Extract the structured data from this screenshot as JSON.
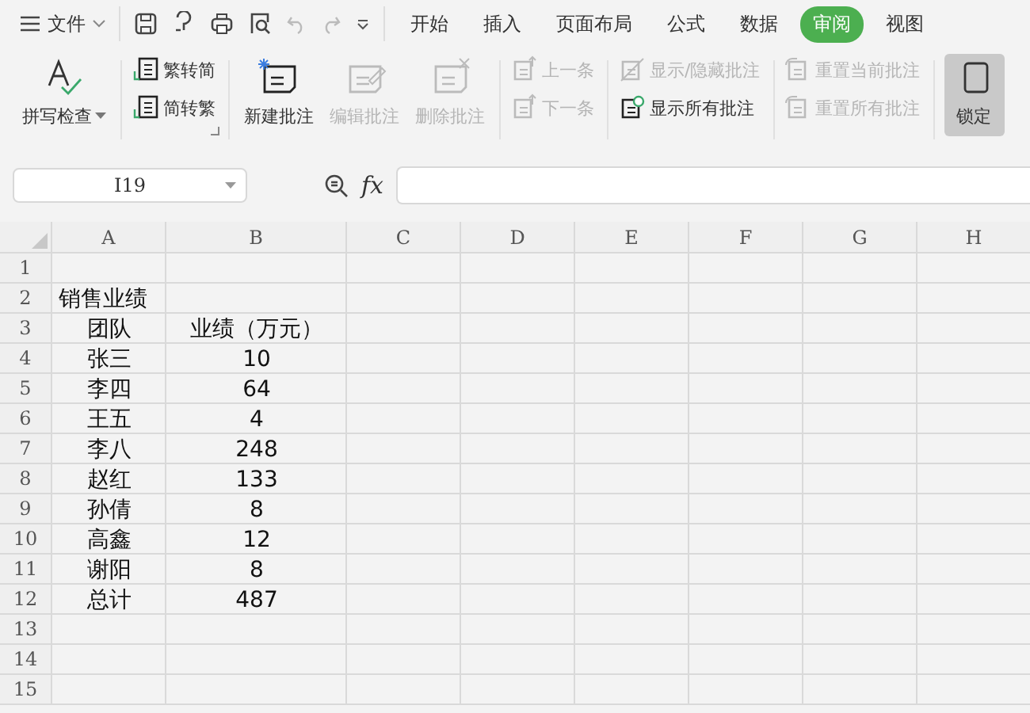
{
  "file_menu": {
    "label": "文件"
  },
  "tabs": [
    {
      "label": "开始",
      "selected": false
    },
    {
      "label": "插入",
      "selected": false
    },
    {
      "label": "页面布局",
      "selected": false
    },
    {
      "label": "公式",
      "selected": false
    },
    {
      "label": "数据",
      "selected": false
    },
    {
      "label": "审阅",
      "selected": true
    },
    {
      "label": "视图",
      "selected": false
    }
  ],
  "ribbon": [
    {
      "items": [
        {
          "kind": "big",
          "label": "拼写检查",
          "disabled": false,
          "dropdown": true
        }
      ]
    },
    {
      "items": [
        {
          "kind": "small",
          "label": "繁转简",
          "disabled": false
        },
        {
          "kind": "small",
          "label": "简转繁",
          "disabled": false
        }
      ]
    },
    {
      "items": [
        {
          "kind": "big",
          "label": "新建批注",
          "disabled": false
        },
        {
          "kind": "big",
          "label": "编辑批注",
          "disabled": true
        },
        {
          "kind": "big",
          "label": "删除批注",
          "disabled": true
        }
      ]
    },
    {
      "items": [
        {
          "kind": "small",
          "label": "上一条",
          "disabled": true
        },
        {
          "kind": "small",
          "label": "下一条",
          "disabled": true
        }
      ]
    },
    {
      "items": [
        {
          "kind": "small",
          "label": "显示/隐藏批注",
          "disabled": true
        },
        {
          "kind": "small",
          "label": "显示所有批注",
          "disabled": false
        }
      ]
    },
    {
      "items": [
        {
          "kind": "small",
          "label": "重置当前批注",
          "disabled": true
        },
        {
          "kind": "small",
          "label": "重置所有批注",
          "disabled": true
        }
      ]
    },
    {
      "items": [
        {
          "kind": "big",
          "label": "锁定",
          "disabled": false
        }
      ]
    }
  ],
  "name_box": {
    "value": "I19"
  },
  "formula_label": "fx",
  "columns": [
    "A",
    "B",
    "C",
    "D",
    "E",
    "F",
    "G",
    "H"
  ],
  "rows": [
    {
      "num": "1"
    },
    {
      "num": "2",
      "kind": "title",
      "cells": [
        "销售业绩"
      ]
    },
    {
      "num": "3",
      "cells": [
        "团队",
        "业绩（万元）"
      ]
    },
    {
      "num": "4",
      "cells": [
        "张三",
        "10"
      ]
    },
    {
      "num": "5",
      "cells": [
        "李四",
        "64"
      ]
    },
    {
      "num": "6",
      "cells": [
        "王五",
        "4"
      ]
    },
    {
      "num": "7",
      "cells": [
        "李八",
        "248"
      ]
    },
    {
      "num": "8",
      "cells": [
        "赵红",
        "133"
      ]
    },
    {
      "num": "9",
      "cells": [
        "孙倩",
        "8"
      ]
    },
    {
      "num": "10",
      "cells": [
        "高鑫",
        "12"
      ]
    },
    {
      "num": "11",
      "cells": [
        "谢阳",
        "8"
      ]
    },
    {
      "num": "12",
      "cells": [
        "总计",
        "487"
      ]
    },
    {
      "num": "13"
    },
    {
      "num": "14"
    },
    {
      "num": "15"
    }
  ]
}
